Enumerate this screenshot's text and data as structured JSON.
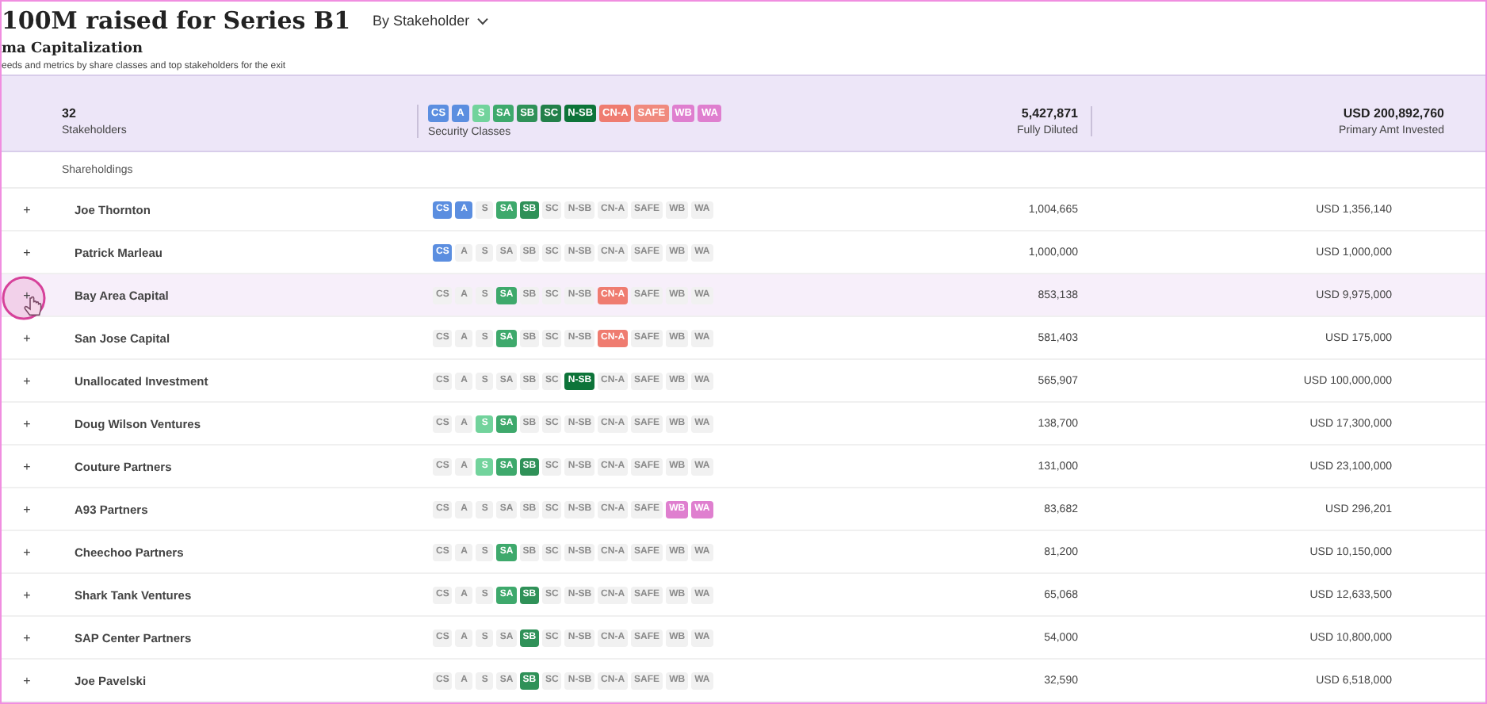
{
  "header": {
    "title": "100M raised for Series B1",
    "view_selector": "By Stakeholder",
    "subtitle": "ma Capitalization",
    "description": "eeds and metrics by share classes and top stakeholders for the exit"
  },
  "summary": {
    "stakeholders_count": "32",
    "stakeholders_label": "Stakeholders",
    "security_classes": [
      {
        "label": "CS",
        "color": "#5b8ee0"
      },
      {
        "label": "A",
        "color": "#5b8ee0"
      },
      {
        "label": "S",
        "color": "#72d39c"
      },
      {
        "label": "SA",
        "color": "#3ea96c"
      },
      {
        "label": "SB",
        "color": "#2f9158"
      },
      {
        "label": "SC",
        "color": "#23804a"
      },
      {
        "label": "N-SB",
        "color": "#0d7439"
      },
      {
        "label": "CN-A",
        "color": "#ef7c70"
      },
      {
        "label": "SAFE",
        "color": "#f08a7e"
      },
      {
        "label": "WB",
        "color": "#df7fcf"
      },
      {
        "label": "WA",
        "color": "#df7fcf"
      }
    ],
    "security_classes_label": "Security Classes",
    "fully_diluted": "5,427,871",
    "fully_diluted_label": "Fully Diluted",
    "primary_amount": "USD 200,892,760",
    "primary_amount_label": "Primary Amt Invested"
  },
  "section_label": "Shareholdings",
  "rows": [
    {
      "expand": "+",
      "name": "Joe Thornton",
      "highlighted": false,
      "tags": [
        {
          "label": "CS",
          "held": true
        },
        {
          "label": "A",
          "held": true
        },
        {
          "label": "S",
          "held": false
        },
        {
          "label": "SA",
          "held": true
        },
        {
          "label": "SB",
          "held": true
        },
        {
          "label": "SC",
          "held": false
        },
        {
          "label": "N-SB",
          "held": false
        },
        {
          "label": "CN-A",
          "held": false
        },
        {
          "label": "SAFE",
          "held": false
        },
        {
          "label": "WB",
          "held": false
        },
        {
          "label": "WA",
          "held": false
        }
      ],
      "diluted": "1,004,665",
      "amount": "USD 1,356,140"
    },
    {
      "expand": "+",
      "name": "Patrick Marleau",
      "highlighted": false,
      "tags": [
        {
          "label": "CS",
          "held": true
        },
        {
          "label": "A",
          "held": false
        },
        {
          "label": "S",
          "held": false
        },
        {
          "label": "SA",
          "held": false
        },
        {
          "label": "SB",
          "held": false
        },
        {
          "label": "SC",
          "held": false
        },
        {
          "label": "N-SB",
          "held": false
        },
        {
          "label": "CN-A",
          "held": false
        },
        {
          "label": "SAFE",
          "held": false
        },
        {
          "label": "WB",
          "held": false
        },
        {
          "label": "WA",
          "held": false
        }
      ],
      "diluted": "1,000,000",
      "amount": "USD 1,000,000"
    },
    {
      "expand": "+",
      "name": "Bay Area Capital",
      "highlighted": true,
      "tags": [
        {
          "label": "CS",
          "held": false
        },
        {
          "label": "A",
          "held": false
        },
        {
          "label": "S",
          "held": false
        },
        {
          "label": "SA",
          "held": true
        },
        {
          "label": "SB",
          "held": false
        },
        {
          "label": "SC",
          "held": false
        },
        {
          "label": "N-SB",
          "held": false
        },
        {
          "label": "CN-A",
          "held": true
        },
        {
          "label": "SAFE",
          "held": false
        },
        {
          "label": "WB",
          "held": false
        },
        {
          "label": "WA",
          "held": false
        }
      ],
      "diluted": "853,138",
      "amount": "USD 9,975,000"
    },
    {
      "expand": "+",
      "name": "San Jose Capital",
      "highlighted": false,
      "tags": [
        {
          "label": "CS",
          "held": false
        },
        {
          "label": "A",
          "held": false
        },
        {
          "label": "S",
          "held": false
        },
        {
          "label": "SA",
          "held": true
        },
        {
          "label": "SB",
          "held": false
        },
        {
          "label": "SC",
          "held": false
        },
        {
          "label": "N-SB",
          "held": false
        },
        {
          "label": "CN-A",
          "held": true
        },
        {
          "label": "SAFE",
          "held": false
        },
        {
          "label": "WB",
          "held": false
        },
        {
          "label": "WA",
          "held": false
        }
      ],
      "diluted": "581,403",
      "amount": "USD 175,000"
    },
    {
      "expand": "+",
      "name": "Unallocated Investment",
      "highlighted": false,
      "tags": [
        {
          "label": "CS",
          "held": false
        },
        {
          "label": "A",
          "held": false
        },
        {
          "label": "S",
          "held": false
        },
        {
          "label": "SA",
          "held": false
        },
        {
          "label": "SB",
          "held": false
        },
        {
          "label": "SC",
          "held": false
        },
        {
          "label": "N-SB",
          "held": true
        },
        {
          "label": "CN-A",
          "held": false
        },
        {
          "label": "SAFE",
          "held": false
        },
        {
          "label": "WB",
          "held": false
        },
        {
          "label": "WA",
          "held": false
        }
      ],
      "diluted": "565,907",
      "amount": "USD 100,000,000"
    },
    {
      "expand": "+",
      "name": "Doug Wilson Ventures",
      "highlighted": false,
      "tags": [
        {
          "label": "CS",
          "held": false
        },
        {
          "label": "A",
          "held": false
        },
        {
          "label": "S",
          "held": true
        },
        {
          "label": "SA",
          "held": true
        },
        {
          "label": "SB",
          "held": false
        },
        {
          "label": "SC",
          "held": false
        },
        {
          "label": "N-SB",
          "held": false
        },
        {
          "label": "CN-A",
          "held": false
        },
        {
          "label": "SAFE",
          "held": false
        },
        {
          "label": "WB",
          "held": false
        },
        {
          "label": "WA",
          "held": false
        }
      ],
      "diluted": "138,700",
      "amount": "USD 17,300,000"
    },
    {
      "expand": "+",
      "name": "Couture Partners",
      "highlighted": false,
      "tags": [
        {
          "label": "CS",
          "held": false
        },
        {
          "label": "A",
          "held": false
        },
        {
          "label": "S",
          "held": true
        },
        {
          "label": "SA",
          "held": true
        },
        {
          "label": "SB",
          "held": true
        },
        {
          "label": "SC",
          "held": false
        },
        {
          "label": "N-SB",
          "held": false
        },
        {
          "label": "CN-A",
          "held": false
        },
        {
          "label": "SAFE",
          "held": false
        },
        {
          "label": "WB",
          "held": false
        },
        {
          "label": "WA",
          "held": false
        }
      ],
      "diluted": "131,000",
      "amount": "USD 23,100,000"
    },
    {
      "expand": "+",
      "name": "A93 Partners",
      "highlighted": false,
      "tags": [
        {
          "label": "CS",
          "held": false
        },
        {
          "label": "A",
          "held": false
        },
        {
          "label": "S",
          "held": false
        },
        {
          "label": "SA",
          "held": false
        },
        {
          "label": "SB",
          "held": false
        },
        {
          "label": "SC",
          "held": false
        },
        {
          "label": "N-SB",
          "held": false
        },
        {
          "label": "CN-A",
          "held": false
        },
        {
          "label": "SAFE",
          "held": false
        },
        {
          "label": "WB",
          "held": true
        },
        {
          "label": "WA",
          "held": true
        }
      ],
      "diluted": "83,682",
      "amount": "USD 296,201"
    },
    {
      "expand": "+",
      "name": "Cheechoo Partners",
      "highlighted": false,
      "tags": [
        {
          "label": "CS",
          "held": false
        },
        {
          "label": "A",
          "held": false
        },
        {
          "label": "S",
          "held": false
        },
        {
          "label": "SA",
          "held": true
        },
        {
          "label": "SB",
          "held": false
        },
        {
          "label": "SC",
          "held": false
        },
        {
          "label": "N-SB",
          "held": false
        },
        {
          "label": "CN-A",
          "held": false
        },
        {
          "label": "SAFE",
          "held": false
        },
        {
          "label": "WB",
          "held": false
        },
        {
          "label": "WA",
          "held": false
        }
      ],
      "diluted": "81,200",
      "amount": "USD 10,150,000"
    },
    {
      "expand": "+",
      "name": "Shark Tank Ventures",
      "highlighted": false,
      "tags": [
        {
          "label": "CS",
          "held": false
        },
        {
          "label": "A",
          "held": false
        },
        {
          "label": "S",
          "held": false
        },
        {
          "label": "SA",
          "held": true
        },
        {
          "label": "SB",
          "held": true
        },
        {
          "label": "SC",
          "held": false
        },
        {
          "label": "N-SB",
          "held": false
        },
        {
          "label": "CN-A",
          "held": false
        },
        {
          "label": "SAFE",
          "held": false
        },
        {
          "label": "WB",
          "held": false
        },
        {
          "label": "WA",
          "held": false
        }
      ],
      "diluted": "65,068",
      "amount": "USD 12,633,500"
    },
    {
      "expand": "+",
      "name": "SAP Center Partners",
      "highlighted": false,
      "tags": [
        {
          "label": "CS",
          "held": false
        },
        {
          "label": "A",
          "held": false
        },
        {
          "label": "S",
          "held": false
        },
        {
          "label": "SA",
          "held": false
        },
        {
          "label": "SB",
          "held": true
        },
        {
          "label": "SC",
          "held": false
        },
        {
          "label": "N-SB",
          "held": false
        },
        {
          "label": "CN-A",
          "held": false
        },
        {
          "label": "SAFE",
          "held": false
        },
        {
          "label": "WB",
          "held": false
        },
        {
          "label": "WA",
          "held": false
        }
      ],
      "diluted": "54,000",
      "amount": "USD 10,800,000"
    },
    {
      "expand": "+",
      "name": "Joe Pavelski",
      "highlighted": false,
      "tags": [
        {
          "label": "CS",
          "held": false
        },
        {
          "label": "A",
          "held": false
        },
        {
          "label": "S",
          "held": false
        },
        {
          "label": "SA",
          "held": false
        },
        {
          "label": "SB",
          "held": true
        },
        {
          "label": "SC",
          "held": false
        },
        {
          "label": "N-SB",
          "held": false
        },
        {
          "label": "CN-A",
          "held": false
        },
        {
          "label": "SAFE",
          "held": false
        },
        {
          "label": "WB",
          "held": false
        },
        {
          "label": "WA",
          "held": false
        }
      ],
      "diluted": "32,590",
      "amount": "USD 6,518,000"
    }
  ]
}
